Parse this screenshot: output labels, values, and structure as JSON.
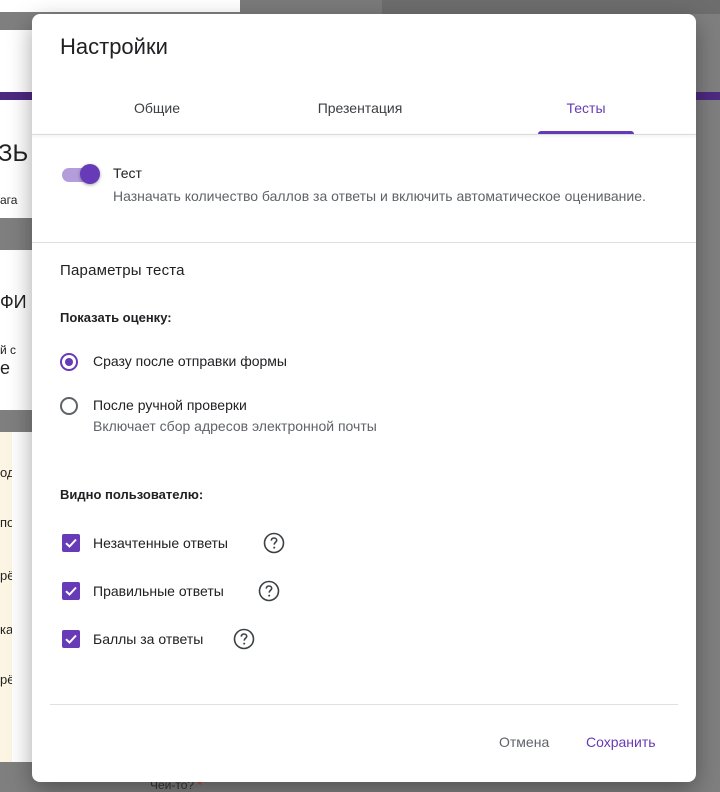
{
  "background": {
    "fragments": [
      "ЗЬ",
      "ага",
      "ФИ",
      "й с",
      "е",
      "од",
      "по.",
      "рё",
      "ка",
      "рё"
    ],
    "bottom_text": "Чей-то? ",
    "required_mark": "*"
  },
  "dialog": {
    "title": "Настройки",
    "tabs": [
      {
        "label": "Общие",
        "active": false
      },
      {
        "label": "Презентация",
        "active": false
      },
      {
        "label": "Тесты",
        "active": true
      }
    ],
    "quiz_toggle": {
      "label": "Тест",
      "description": "Назначать количество баллов за ответы и включить автоматическое оценивание.",
      "on": true
    },
    "params_title": "Параметры теста",
    "show_grade": {
      "heading": "Показать оценку:",
      "options": [
        {
          "label": "Сразу после отправки формы",
          "sublabel": "",
          "checked": true
        },
        {
          "label": "После ручной проверки",
          "sublabel": "Включает сбор адресов электронной почты",
          "checked": false
        }
      ]
    },
    "visible_to_user": {
      "heading": "Видно пользователю:",
      "options": [
        {
          "label": "Незачтенные ответы",
          "checked": true,
          "help_icon": "help-circle-icon"
        },
        {
          "label": "Правильные ответы",
          "checked": true,
          "help_icon": "help-circle-icon"
        },
        {
          "label": "Баллы за ответы",
          "checked": true,
          "help_icon": "help-circle-icon"
        }
      ]
    },
    "buttons": {
      "cancel": "Отмена",
      "save": "Сохранить"
    }
  },
  "colors": {
    "accent": "#673ab7",
    "overlay": "#7f7f7f"
  }
}
